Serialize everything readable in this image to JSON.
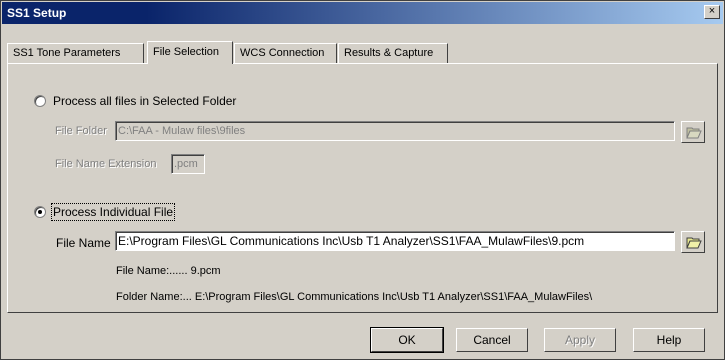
{
  "window": {
    "title": "SS1 Setup",
    "close_symbol": "×"
  },
  "tabs": [
    {
      "label": "SS1 Tone Parameters",
      "active": false
    },
    {
      "label": "File Selection",
      "active": true
    },
    {
      "label": "WCS Connection",
      "active": false
    },
    {
      "label": "Results & Capture",
      "active": false
    }
  ],
  "folder_mode": {
    "radio_label": "Process all files in Selected Folder",
    "selected": false,
    "folder_label": "File Folder",
    "folder_value": "C:\\FAA - Mulaw files\\9files",
    "ext_label": "File Name Extension",
    "ext_value": ".pcm",
    "browse_icon": "folder-open-icon"
  },
  "file_mode": {
    "radio_label": "Process Individual File",
    "selected": true,
    "file_label": "File Name",
    "file_value": "E:\\Program Files\\GL Communications Inc\\Usb T1 Analyzer\\SS1\\FAA_MulawFiles\\9.pcm",
    "browse_icon": "folder-open-icon",
    "info_file_name": "File Name:...... 9.pcm",
    "info_folder_name": "Folder Name:... E:\\Program Files\\GL Communications Inc\\Usb T1 Analyzer\\SS1\\FAA_MulawFiles\\"
  },
  "buttons": {
    "ok": "OK",
    "cancel": "Cancel",
    "apply": "Apply",
    "help": "Help"
  },
  "colors": {
    "titlebar_start": "#0a246a",
    "titlebar_end": "#a6caf0",
    "face": "#d4d0c8"
  }
}
